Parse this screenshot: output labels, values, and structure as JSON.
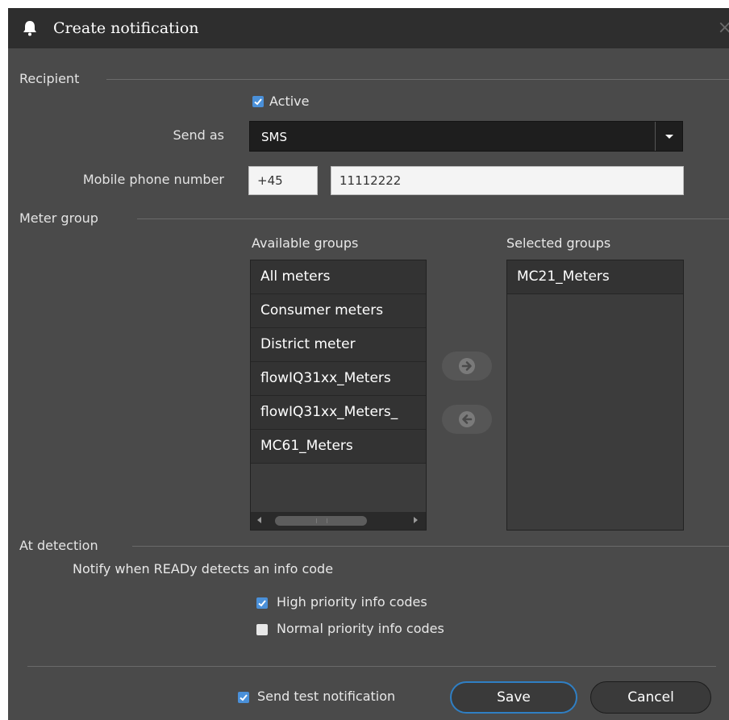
{
  "dialog": {
    "title": "Create notification",
    "close_glyph": "×"
  },
  "recipient": {
    "section_label": "Recipient",
    "active": {
      "label": "Active",
      "checked": true
    },
    "send_as": {
      "label": "Send as",
      "value": "SMS"
    },
    "mobile": {
      "label": "Mobile phone number",
      "country_code": "+45",
      "number": "11112222"
    }
  },
  "meter_group": {
    "section_label": "Meter group",
    "available_label": "Available groups",
    "selected_label": "Selected groups",
    "available": [
      "All meters",
      "Consumer meters",
      "District meter",
      "flowIQ31xx_Meters",
      "flowIQ31xx_Meters_",
      "MC61_Meters"
    ],
    "selected": [
      "MC21_Meters"
    ]
  },
  "detection": {
    "section_label": "At detection",
    "description": "Notify when READy detects an info code",
    "high_priority": {
      "label": "High priority info codes",
      "checked": true
    },
    "normal_priority": {
      "label": "Normal priority info codes",
      "checked": false
    }
  },
  "footer": {
    "send_test": {
      "label": "Send test notification",
      "checked": true
    },
    "save_label": "Save",
    "cancel_label": "Cancel"
  },
  "icons": {
    "title": "bell-icon",
    "close": "close-icon",
    "dropdown": "chevron-down-icon",
    "add": "arrow-right-icon",
    "remove": "arrow-left-icon",
    "check": "check-icon"
  },
  "colors": {
    "dialog_bg": "#4a4a4a",
    "titlebar_bg": "#2e2e2e",
    "checkbox_accent": "#4a90d9",
    "save_border": "#2f7fc4"
  }
}
